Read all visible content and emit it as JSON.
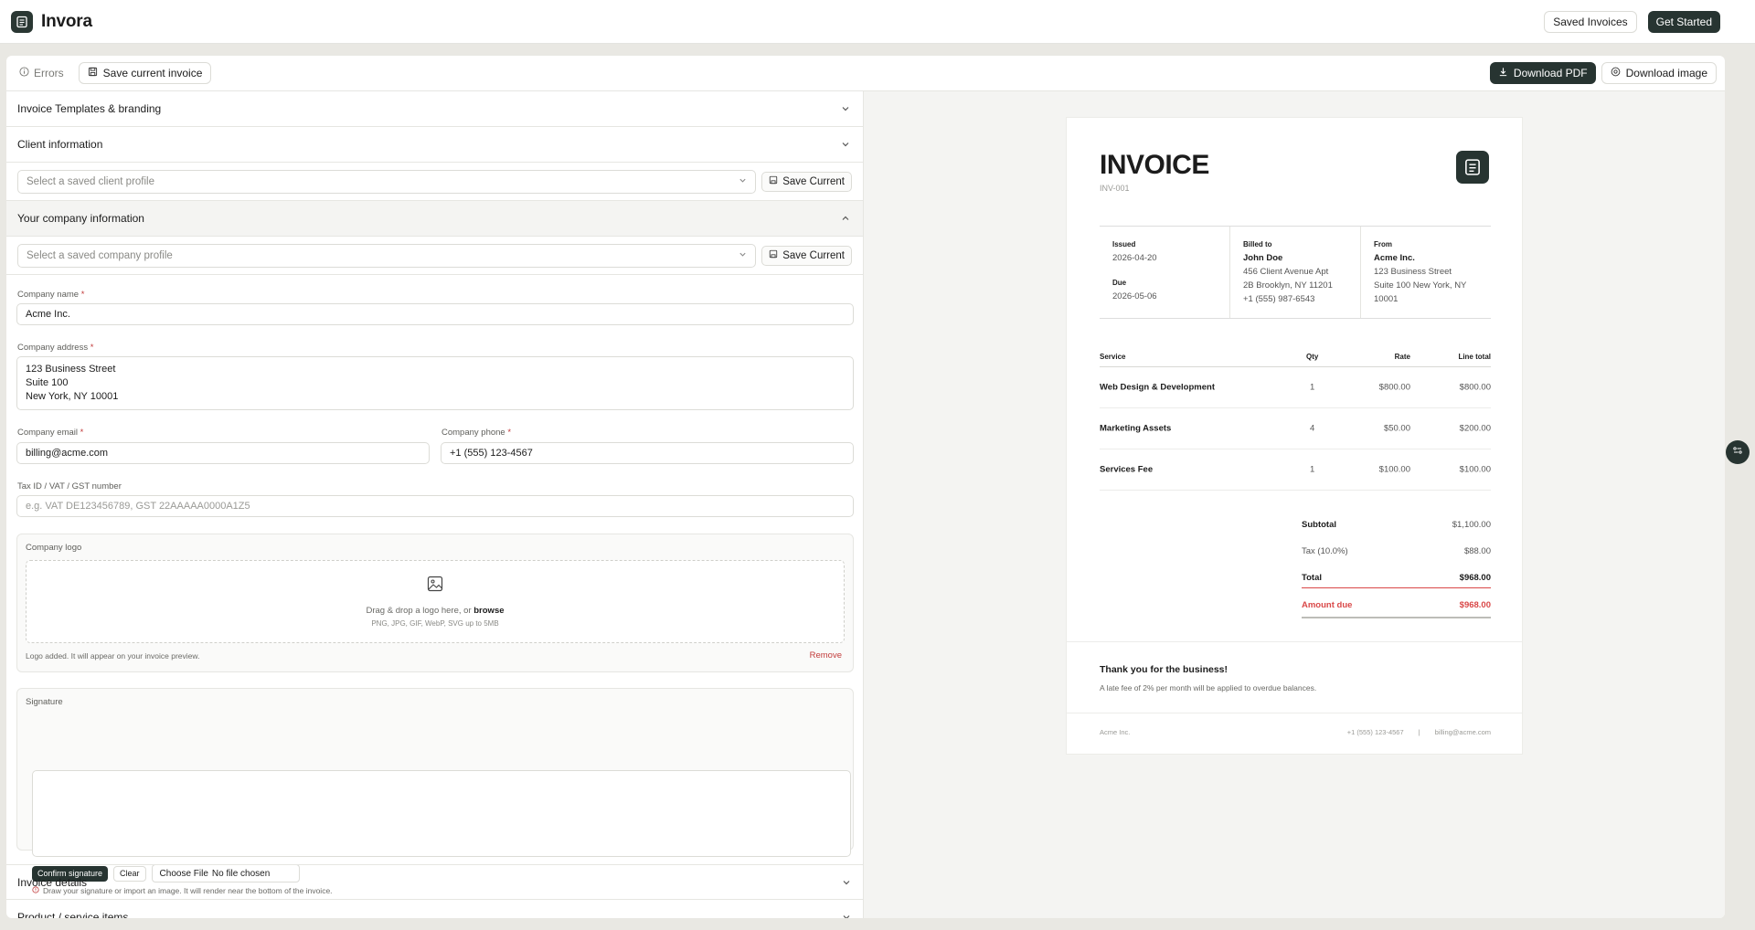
{
  "app": {
    "name": "Invora"
  },
  "topbar": {
    "saved_invoices": "Saved Invoices",
    "get_started": "Get Started"
  },
  "toolbar": {
    "errors": "Errors",
    "save_current_invoice": "Save current invoice",
    "download_pdf": "Download PDF",
    "download_image": "Download image"
  },
  "sections": {
    "templates": "Invoice Templates & branding",
    "client": "Client information",
    "company": "Your company information",
    "invoice_details": "Invoice details",
    "products": "Product / service items"
  },
  "client_profile": {
    "placeholder": "Select a saved client profile",
    "save": "Save Current"
  },
  "company_profile": {
    "placeholder": "Select a saved company profile",
    "save": "Save Current"
  },
  "company_form": {
    "name_label": "Company name",
    "name_value": "Acme Inc.",
    "address_label": "Company address",
    "address_value": "123 Business Street\nSuite 100\nNew York, NY 10001",
    "email_label": "Company email",
    "email_value": "billing@acme.com",
    "phone_label": "Company phone",
    "phone_value": "+1 (555) 123-4567",
    "tax_label": "Tax ID / VAT / GST number",
    "tax_placeholder": "e.g. VAT DE123456789, GST 22AAAAA0000A1Z5",
    "required_mark": "*"
  },
  "logo": {
    "label": "Company logo",
    "drop_text": "Drag & drop a logo here, or",
    "browse": "browse",
    "formats": "PNG, JPG, GIF, WebP, SVG up to 5MB",
    "status": "Logo added. It will appear on your invoice preview.",
    "remove": "Remove"
  },
  "signature": {
    "label": "Signature",
    "confirm": "Confirm signature",
    "clear": "Clear",
    "choose_file": "Choose File",
    "no_file": "No file chosen",
    "hint": "Draw your signature or import an image. It will render near the bottom of the invoice."
  },
  "invoice": {
    "title": "INVOICE",
    "number": "INV-001",
    "issued_label": "Issued",
    "issued": "2026-04-20",
    "due_label": "Due",
    "due": "2026-05-06",
    "billed_label": "Billed to",
    "billed_name": "John Doe",
    "billed_addr1": "456 Client Avenue Apt",
    "billed_addr2": "2B Brooklyn, NY 11201",
    "billed_phone": "+1 (555) 987-6543",
    "from_label": "From",
    "from_name": "Acme Inc.",
    "from_addr1": "123 Business Street",
    "from_addr2": "Suite 100 New York, NY",
    "from_addr3": "10001",
    "columns": {
      "service": "Service",
      "qty": "Qty",
      "rate": "Rate",
      "line_total": "Line total"
    },
    "items": [
      {
        "service": "Web Design & Development",
        "qty": "1",
        "rate": "$800.00",
        "total": "$800.00"
      },
      {
        "service": "Marketing Assets",
        "qty": "4",
        "rate": "$50.00",
        "total": "$200.00"
      },
      {
        "service": "Services Fee",
        "qty": "1",
        "rate": "$100.00",
        "total": "$100.00"
      }
    ],
    "subtotal_label": "Subtotal",
    "subtotal": "$1,100.00",
    "tax_label": "Tax (10.0%)",
    "tax": "$88.00",
    "total_label": "Total",
    "total": "$968.00",
    "amount_due_label": "Amount due",
    "amount_due": "$968.00",
    "thanks": "Thank you for the business!",
    "late_fee": "A late fee of 2% per month will be applied to overdue balances.",
    "footer_company": "Acme Inc.",
    "footer_phone": "+1 (555) 123-4567",
    "footer_sep": "|",
    "footer_email": "billing@acme.com"
  },
  "colors": {
    "accent_dark": "#273431",
    "danger": "#c23b3b"
  }
}
